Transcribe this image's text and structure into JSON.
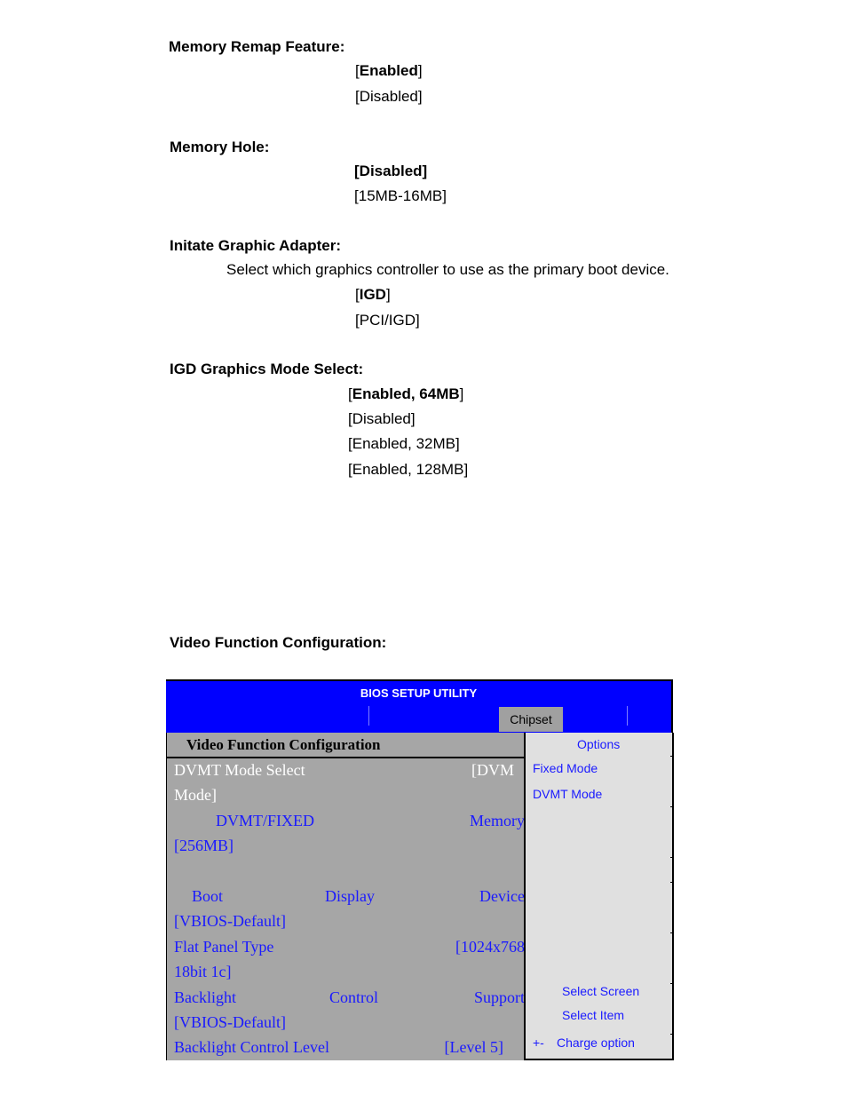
{
  "settings": [
    {
      "title": "Memory Remap Feature:",
      "options": [
        {
          "label": "Enabled",
          "default": true
        },
        {
          "label": "Disabled",
          "default": false
        }
      ]
    },
    {
      "title": "Memory Hole:",
      "options": [
        {
          "label": "Disabled",
          "default": true
        },
        {
          "label": "15MB-16MB",
          "default": false
        }
      ]
    },
    {
      "title": "Initate Graphic Adapter:",
      "description": "Select which graphics controller to use as the primary boot device.",
      "options": [
        {
          "label": "IGD",
          "default": true
        },
        {
          "label": "PCI/IGD",
          "default": false
        }
      ]
    },
    {
      "title": "IGD Graphics Mode Select:",
      "options": [
        {
          "label": "Enabled, 64MB",
          "default": true
        },
        {
          "label": "Disabled",
          "default": false
        },
        {
          "label": "Enabled, 32MB",
          "default": false
        },
        {
          "label": "Enabled, 128MB",
          "default": false
        }
      ]
    }
  ],
  "video_section_heading": "Video Function Configuration:",
  "bios": {
    "title": "BIOS SETUP UTILITY",
    "active_tab": "Chipset",
    "colors": {
      "title_bar": "#0000ff",
      "left_pane": "#a6a6a6",
      "right_pane": "#e0e0e0",
      "item_text": "#1a1aff"
    },
    "section_title": "Video Function Configuration",
    "items": [
      {
        "line1": [
          "DVMT  Mode  Select",
          "[DVM"
        ],
        "line2": "Mode]",
        "selected": true
      },
      {
        "line1": [
          "DVMT/FIXED",
          "Memory"
        ],
        "line2": "[256MB]",
        "selected": false
      },
      {
        "line1": [
          "Boot",
          "Display",
          "Device"
        ],
        "line2": "[VBIOS-Default]",
        "selected": false
      },
      {
        "line1": [
          "Flat  Panel  Type",
          "[1024x768"
        ],
        "line2": "18bit 1c]",
        "selected": false
      },
      {
        "line1": [
          "Backlight",
          "Control",
          "Support"
        ],
        "line2": "[VBIOS-Default]",
        "selected": false
      },
      {
        "line1": [
          "Backlight Control Level",
          "[Level 5]"
        ],
        "selected": false
      }
    ],
    "help": {
      "options_title": "Options",
      "options": [
        "Fixed Mode",
        "DVMT Mode"
      ],
      "keys": [
        {
          "key": "",
          "label": "Select Screen"
        },
        {
          "key": "",
          "label": "Select Item"
        },
        {
          "key": "+-",
          "label": "Charge option"
        }
      ]
    }
  }
}
